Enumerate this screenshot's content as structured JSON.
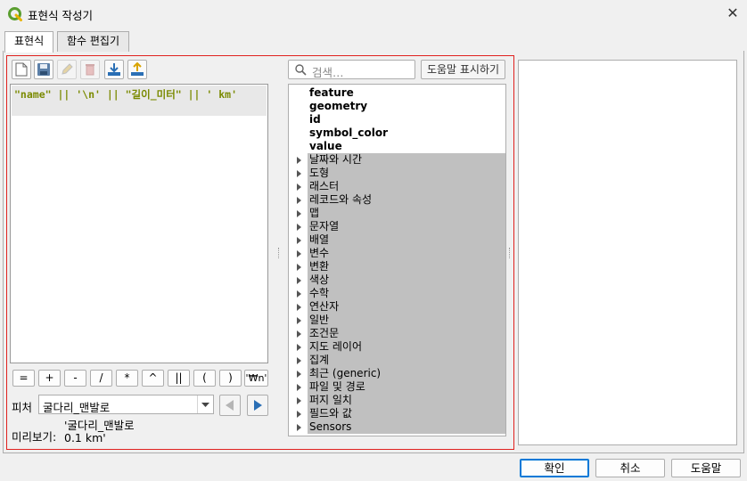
{
  "window": {
    "title": "표현식 작성기",
    "close_glyph": "✕"
  },
  "tabs": [
    {
      "label": "표현식",
      "active": true
    },
    {
      "label": "함수 편집기",
      "active": false
    }
  ],
  "toolbar": {
    "icons": [
      "new-file-icon",
      "save-icon",
      "edit-icon",
      "delete-icon",
      "import-icon",
      "export-icon"
    ]
  },
  "editor": {
    "code": "\"name\" || '\\n' || \"길이_미터\" || ' km'"
  },
  "operators": [
    "=",
    "+",
    "-",
    "/",
    "*",
    "^",
    "||",
    "(",
    ")",
    "'₩n'"
  ],
  "feature": {
    "label": "피처",
    "value": "굴다리_맨발로"
  },
  "preview": {
    "label": "미리보기:",
    "line1": "'굴다리_맨발로",
    "line2": "0.1 km'"
  },
  "search": {
    "placeholder": "검색…"
  },
  "show_help_label": "도움말 표시하기",
  "function_tree": {
    "fields": [
      "feature",
      "geometry",
      "id",
      "symbol_color",
      "value"
    ],
    "groups": [
      "날짜와 시간",
      "도형",
      "래스터",
      "레코드와 속성",
      "맵",
      "문자열",
      "배열",
      "변수",
      "변환",
      "색상",
      "수학",
      "연산자",
      "일반",
      "조건문",
      "지도 레이어",
      "집계",
      "최근 (generic)",
      "파일 및 경로",
      "퍼지 일치",
      "필드와 값",
      "Sensors"
    ]
  },
  "buttons": {
    "ok": "확인",
    "cancel": "취소",
    "help": "도움말"
  },
  "colors": {
    "highlight_box": "#e0211f",
    "code_text": "#7a8a00",
    "group_row_bg": "#c0c0c0"
  }
}
